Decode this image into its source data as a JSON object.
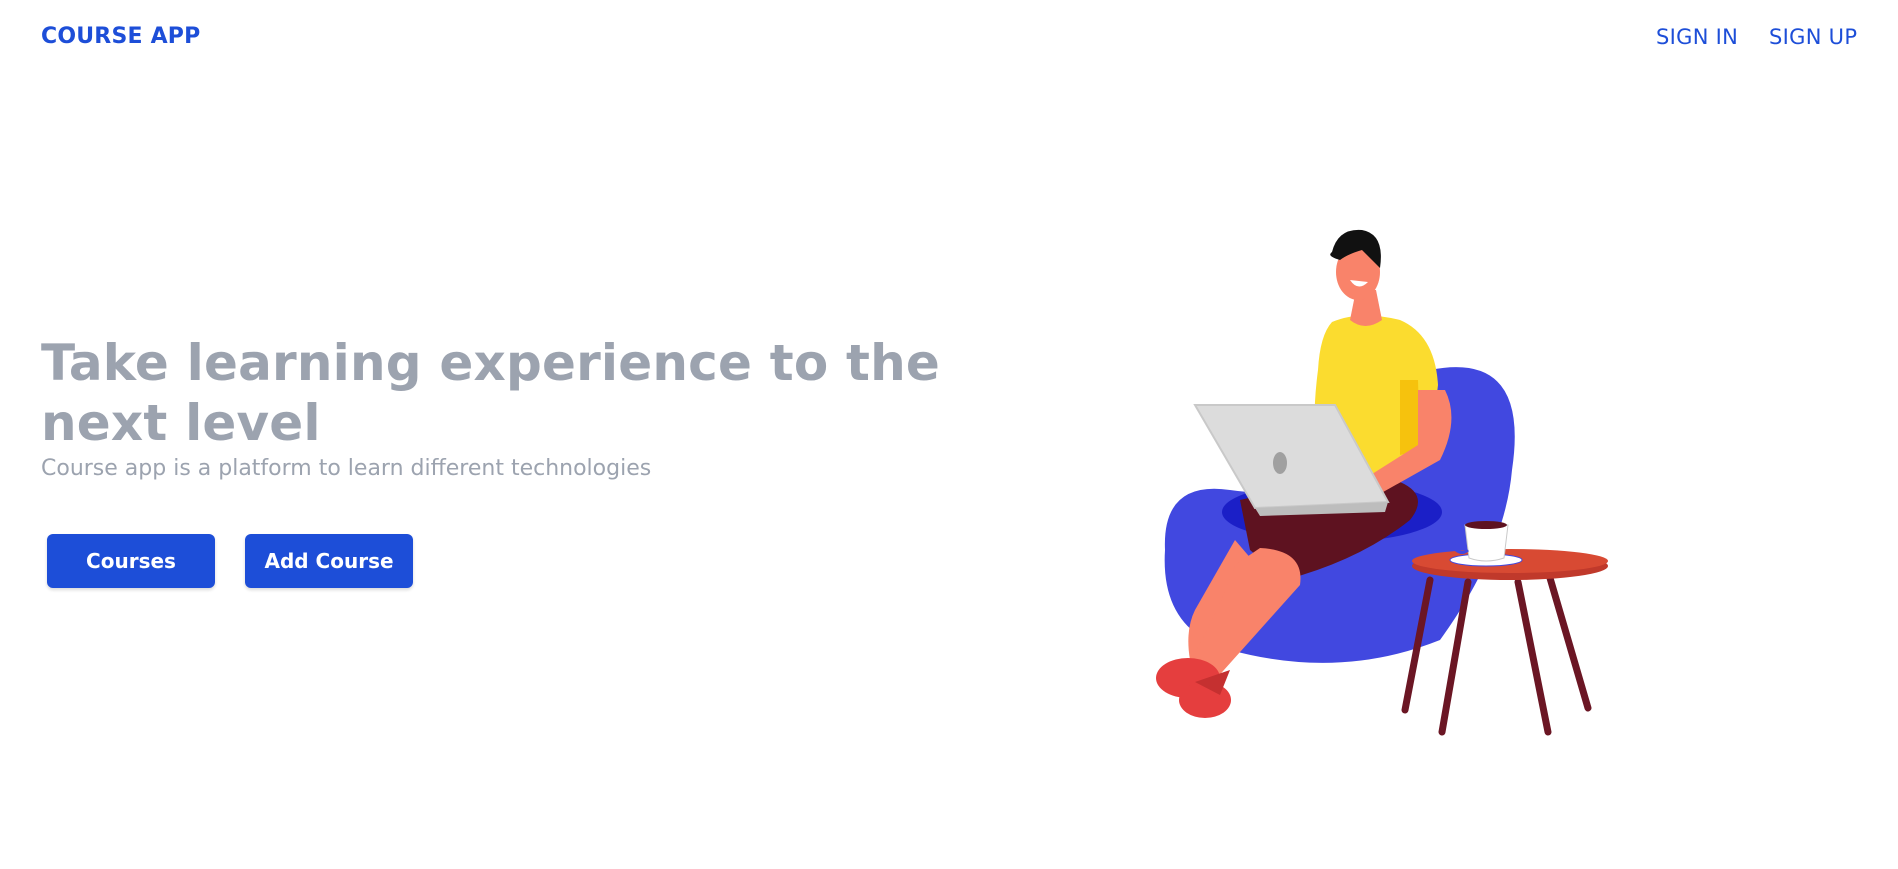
{
  "navbar": {
    "brand": "COURSE APP",
    "links": [
      {
        "label": "SIGN IN"
      },
      {
        "label": "SIGN UP"
      }
    ]
  },
  "hero": {
    "title": "Take learning experience to the next level",
    "subtitle": "Course app is a platform to learn different technologies",
    "buttons": {
      "courses": "Courses",
      "add_course": "Add Course"
    }
  },
  "illustration": {
    "icon": "person-with-laptop-illustration"
  },
  "colors": {
    "primary": "#1d4ed8",
    "muted_text": "#9ca3af",
    "chair": "#4148e0",
    "shirt": "#fbdc2f",
    "skin": "#f9836a",
    "shorts": "#5e1220",
    "table": "#c0392b",
    "table_legs": "#6b1624",
    "laptop": "#dcdcdc"
  }
}
